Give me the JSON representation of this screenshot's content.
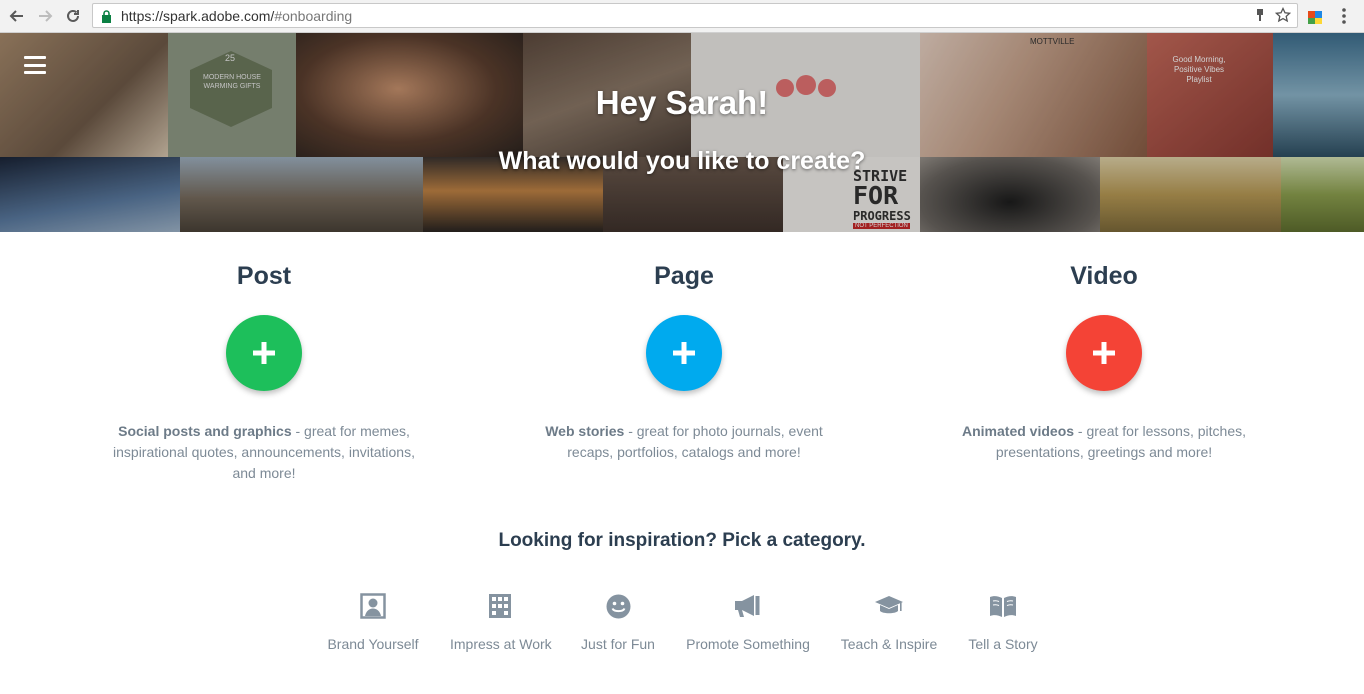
{
  "browser": {
    "url_base": "https://spark.adobe.com/",
    "url_hash": "#onboarding"
  },
  "hero": {
    "title": "Hey Sarah!",
    "subtitle": "What would you like to create?",
    "tile_texts": {
      "gifts_number": "25",
      "gifts": "MODERN HOUSE WARMING GIFTS",
      "strive": "STRIVE",
      "for": "FOR",
      "progress": "PROGRESS",
      "not_perfection": "NOT PERFECTION",
      "good_morning": "Good Morning, Positive Vibes Playlist",
      "mottville": "MOTTVILLE"
    }
  },
  "options": [
    {
      "title": "Post",
      "color": "#1dbf5b",
      "bold": "Social posts and graphics",
      "rest": " - great for memes, inspirational quotes, announcements, invitations, and more!"
    },
    {
      "title": "Page",
      "color": "#00aaee",
      "bold": "Web stories",
      "rest": " - great for photo journals, event recaps, portfolios, catalogs and more!"
    },
    {
      "title": "Video",
      "color": "#f44336",
      "bold": "Animated videos",
      "rest": " - great for lessons, pitches, presentations, greetings and more!"
    }
  ],
  "inspiration": {
    "heading": "Looking for inspiration? Pick a category.",
    "categories": [
      {
        "label": "Brand Yourself",
        "icon": "portrait-icon"
      },
      {
        "label": "Impress at Work",
        "icon": "building-icon"
      },
      {
        "label": "Just for Fun",
        "icon": "smiley-icon"
      },
      {
        "label": "Promote Something",
        "icon": "megaphone-icon"
      },
      {
        "label": "Teach & Inspire",
        "icon": "graduation-cap-icon"
      },
      {
        "label": "Tell a Story",
        "icon": "book-icon"
      }
    ]
  },
  "colors": {
    "heading": "#2c3e50",
    "muted": "#7d8a96",
    "icon": "#8593a0"
  }
}
